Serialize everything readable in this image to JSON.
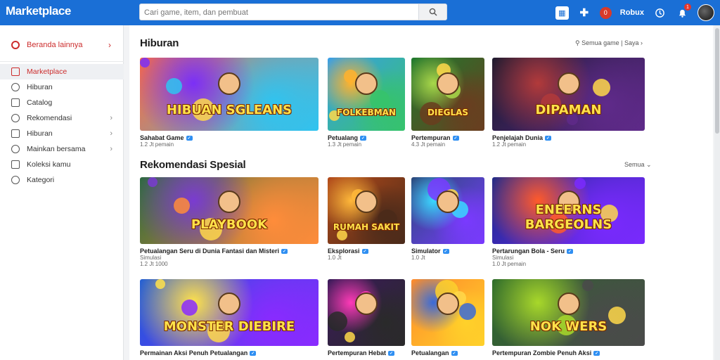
{
  "header": {
    "logo": "Marketplace",
    "search_placeholder": "Cari game, item, dan pembuat",
    "icons": [
      "catalog-icon",
      "build-icon",
      "robux-icon",
      "currency-text",
      "settings-icon",
      "notifications-icon",
      "avatar"
    ],
    "robux_amount": "0",
    "notification_count": "1",
    "colors": {
      "bar": "#1a6fd6",
      "accent": "#cc2d2d"
    }
  },
  "sidebar": {
    "header_label": "Beranda lainnya",
    "items": [
      {
        "label": "Marketplace",
        "icon": "store-icon",
        "active": true,
        "chevron": false
      },
      {
        "label": "Hiburan",
        "icon": "user-icon",
        "active": false,
        "chevron": false
      },
      {
        "label": "Catalog",
        "icon": "catalog-icon",
        "active": false,
        "chevron": false
      },
      {
        "label": "Rekomendasi",
        "icon": "list-icon",
        "active": false,
        "chevron": true
      },
      {
        "label": "Hiburan",
        "icon": "gamepad-icon",
        "active": false,
        "chevron": true
      },
      {
        "label": "Mainkan bersama",
        "icon": "group-icon",
        "active": false,
        "chevron": true
      },
      {
        "label": "Koleksi kamu",
        "icon": "folder-icon",
        "active": false,
        "chevron": false
      },
      {
        "label": "Kategori",
        "icon": "tag-icon",
        "active": false,
        "chevron": false
      }
    ]
  },
  "sections": [
    {
      "title": "Hiburan",
      "link": "Semua game",
      "link2": "Saya",
      "cards": [
        {
          "name": "Sahabat Game",
          "meta": "1.2 Jt pemain",
          "art": "HIBUAN SGLEANS",
          "colors": [
            "#ff6a3d",
            "#7b2ff7",
            "#2ec4f1"
          ]
        },
        {
          "name": "Petualang",
          "meta": "1.3 Jt pemain",
          "art": "FOLKEBMAN",
          "colors": [
            "#3a9ee8",
            "#ffb22e",
            "#36c36b"
          ]
        },
        {
          "name": "Pertempuran",
          "meta": "4.3 Jt pemain",
          "art": "DIEGLAS",
          "colors": [
            "#1f7a2e",
            "#a8d84a",
            "#6a3d1f"
          ]
        },
        {
          "name": "Penjelajah Dunia",
          "meta": "1.2 Jt pemain",
          "art": "DIPAMAN",
          "colors": [
            "#1a1a2e",
            "#b23a3a",
            "#5f2a8a"
          ]
        }
      ]
    },
    {
      "title": "Rekomendasi Spesial",
      "link": "Semua",
      "cards": [
        {
          "name": "Petualangan Seru di Dunia Fantasi dan Misteri",
          "meta": "Simulasi",
          "meta2": "1.2 Jt 1000",
          "art": "PLAYBOOK",
          "colors": [
            "#2a6b3a",
            "#7a3bd1",
            "#ff8c3a"
          ]
        },
        {
          "name": "Eksplorasi",
          "meta": "1.0 Jt",
          "art": "RUMAH SAKIT",
          "colors": [
            "#b34a1a",
            "#ffb83a",
            "#4a2a1a"
          ]
        },
        {
          "name": "Simulator",
          "meta": "1.0 Jt",
          "art": "",
          "colors": [
            "#2a4a7a",
            "#3ad8ff",
            "#7a3aff"
          ]
        },
        {
          "name": "Pertarungan Bola - Seru",
          "meta": "Simulasi",
          "meta2": "1.0 Jt pemain",
          "art": "ENEERNS BARGEOLNS",
          "colors": [
            "#1a2a8a",
            "#ff5a2a",
            "#7a2aff"
          ]
        }
      ]
    },
    {
      "title": "",
      "cards": [
        {
          "name": "Permainan Aksi Penuh Petualangan",
          "meta": "",
          "art": "MONSTER DIEBIRE",
          "colors": [
            "#1a5ad8",
            "#ffe24a",
            "#8a2aff"
          ]
        },
        {
          "name": "Pertempuran Hebat",
          "meta": "",
          "art": "",
          "colors": [
            "#3a1a5a",
            "#ff3ab8",
            "#2a2a2a"
          ]
        },
        {
          "name": "Petualangan",
          "meta": "",
          "art": "",
          "colors": [
            "#ff8a2a",
            "#3a6ad8",
            "#ffd12a"
          ]
        },
        {
          "name": "Pertempuran Zombie Penuh Aksi",
          "meta": "",
          "art": "NOK WERS",
          "colors": [
            "#2a6a2a",
            "#a8d82a",
            "#4a4a4a"
          ]
        }
      ]
    }
  ]
}
